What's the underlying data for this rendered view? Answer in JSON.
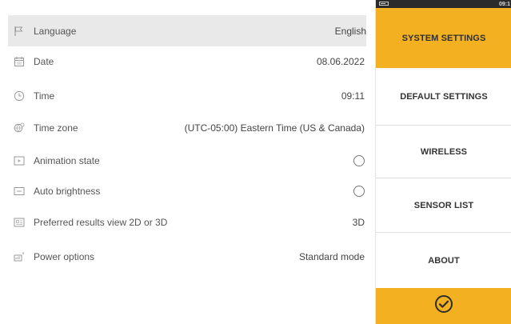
{
  "settings": {
    "rows": [
      {
        "label": "Language",
        "value": "English",
        "icon": "flag-icon"
      },
      {
        "label": "Date",
        "value": "08.06.2022",
        "icon": "calendar-icon"
      },
      {
        "label": "Time",
        "value": "09:11",
        "icon": "clock-icon"
      },
      {
        "label": "Time zone",
        "value": "(UTC-05:00) Eastern Time (US & Canada)",
        "icon": "globe-clock-icon"
      },
      {
        "label": "Animation state",
        "value": "",
        "icon": "animation-icon",
        "control": "radio",
        "checked": false
      },
      {
        "label": "Auto brightness",
        "value": "",
        "icon": "brightness-icon",
        "control": "radio",
        "checked": false
      },
      {
        "label": "Preferred results view 2D or 3D",
        "value": "3D",
        "icon": "view-icon"
      },
      {
        "label": "Power options",
        "value": "Standard mode",
        "icon": "power-icon"
      }
    ],
    "selected_index": 0
  },
  "menu": {
    "status_time": "09:1",
    "items": [
      {
        "label": "SYSTEM SETTINGS",
        "active": true
      },
      {
        "label": "DEFAULT SETTINGS",
        "active": false
      },
      {
        "label": "WIRELESS",
        "active": false
      },
      {
        "label": "SENSOR LIST",
        "active": false
      },
      {
        "label": "ABOUT",
        "active": false
      }
    ],
    "confirm_icon": "check-circle-icon"
  },
  "colors": {
    "accent": "#f3b122",
    "selected_row": "#e9e9e9",
    "statusbar": "#2b2b2b"
  }
}
